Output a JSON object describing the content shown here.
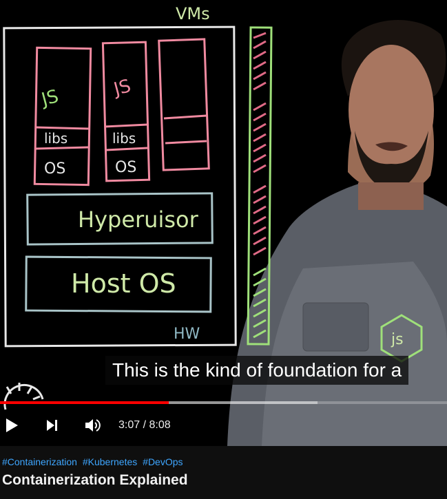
{
  "video": {
    "board": {
      "vms_label": "VMs",
      "js_label_1": "JS",
      "js_label_2": "JS",
      "libs_label_1": "libs",
      "libs_label_2": "libs",
      "os_label_1": "OS",
      "os_label_2": "OS",
      "hypervisor_label": "Hyperuisor",
      "host_os_label": "Host OS",
      "hw_label": "HW"
    },
    "shirt_logo": "js",
    "caption": "This is the kind of foundation for a"
  },
  "player": {
    "progress_fraction": 0.378,
    "loaded_fraction": 0.71,
    "current_time": "3:07",
    "separator": "/",
    "duration": "8:08",
    "icons": [
      "play-icon",
      "next-icon",
      "volume-icon"
    ],
    "played_color": "#ff0000"
  },
  "info": {
    "hashtags": [
      "#Containerization",
      "#Kubernetes",
      "#DevOps"
    ],
    "title": "Containerization Explained"
  }
}
